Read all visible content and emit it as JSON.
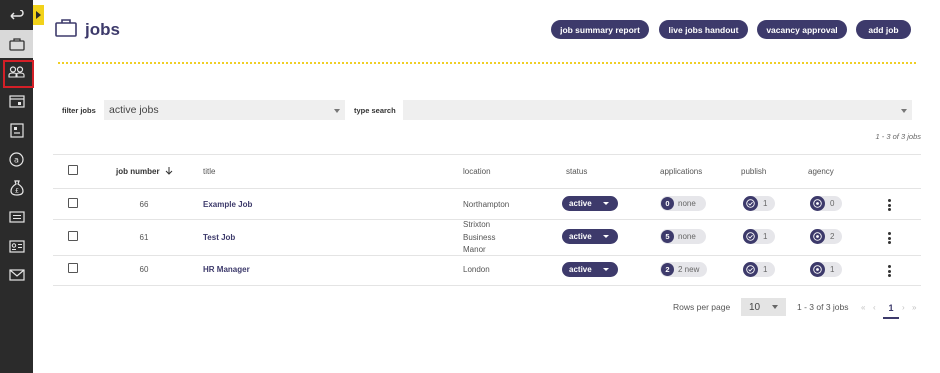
{
  "page": {
    "title": "jobs",
    "header_buttons": [
      "job summary report",
      "live jobs handout",
      "vacancy approval",
      "add job"
    ]
  },
  "filters": {
    "filter_label": "filter jobs",
    "filter_value": "active jobs",
    "search_label": "type search",
    "search_value": ""
  },
  "count_top": "1 - 3 of 3 jobs",
  "table": {
    "columns": {
      "job_number": "job number",
      "title": "title",
      "location": "location",
      "status": "status",
      "applications": "applications",
      "publish": "publish",
      "agency": "agency"
    },
    "sort_icon": "arrow-down-icon",
    "rows": [
      {
        "job_number": "66",
        "title": "Example Job",
        "location": [
          "Northampton"
        ],
        "status": "active",
        "applications_count": "0",
        "applications_label": "none",
        "publish_count": "1",
        "agency_count": "0"
      },
      {
        "job_number": "61",
        "title": "Test Job",
        "location": [
          "Strixton",
          "Business",
          "Manor"
        ],
        "status": "active",
        "applications_count": "5",
        "applications_label": "none",
        "publish_count": "1",
        "agency_count": "2"
      },
      {
        "job_number": "60",
        "title": "HR Manager",
        "location": [
          "London"
        ],
        "status": "active",
        "applications_count": "2",
        "applications_label": "2 new",
        "publish_count": "1",
        "agency_count": "1"
      }
    ]
  },
  "pagination": {
    "rows_per_page_label": "Rows per page",
    "rows_per_page_value": "10",
    "range": "1 - 3 of 3 jobs",
    "first": "«",
    "prev": "‹",
    "current_page": "1",
    "next": "›",
    "last": "»"
  },
  "rail": {
    "icons": [
      "back-arrow-icon",
      "briefcase-icon",
      "people-icon",
      "calendar-icon",
      "report-icon",
      "at-sign-icon",
      "money-bag-icon",
      "monitor-icon",
      "id-card-icon",
      "mail-icon"
    ]
  },
  "colors": {
    "brand": "#3d3a6b",
    "rail_bg": "#2b2b2b",
    "accent_yellow": "#f2d21a",
    "highlight_red": "#d41f27"
  }
}
